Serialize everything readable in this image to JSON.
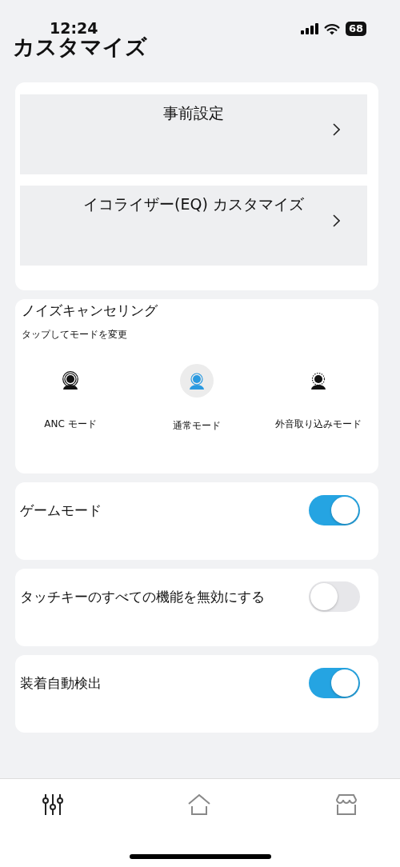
{
  "status_bar": {
    "time": "12:24",
    "battery": "68"
  },
  "title": "カスタマイズ",
  "menu_items": [
    {
      "label": "事前設定"
    },
    {
      "label": "イコライザー(EQ) カスタマイズ"
    }
  ],
  "noise_cancelling": {
    "title": "ノイズキャンセリング",
    "subtitle": "タップしてモードを変更",
    "modes": [
      {
        "label": "ANC モード",
        "kind": "anc",
        "selected": false
      },
      {
        "label": "通常モード",
        "kind": "normal",
        "selected": true
      },
      {
        "label": "外音取り込みモード",
        "kind": "ambient",
        "selected": false
      }
    ]
  },
  "toggles": [
    {
      "label": "ゲームモード",
      "on": true
    },
    {
      "label": "タッチキーのすべての機能を無効にする",
      "on": false
    },
    {
      "label": "装着自動検出",
      "on": true
    }
  ],
  "nav_tabs": [
    {
      "kind": "sliders",
      "selected": true
    },
    {
      "kind": "home",
      "selected": false
    },
    {
      "kind": "store",
      "selected": false
    }
  ]
}
